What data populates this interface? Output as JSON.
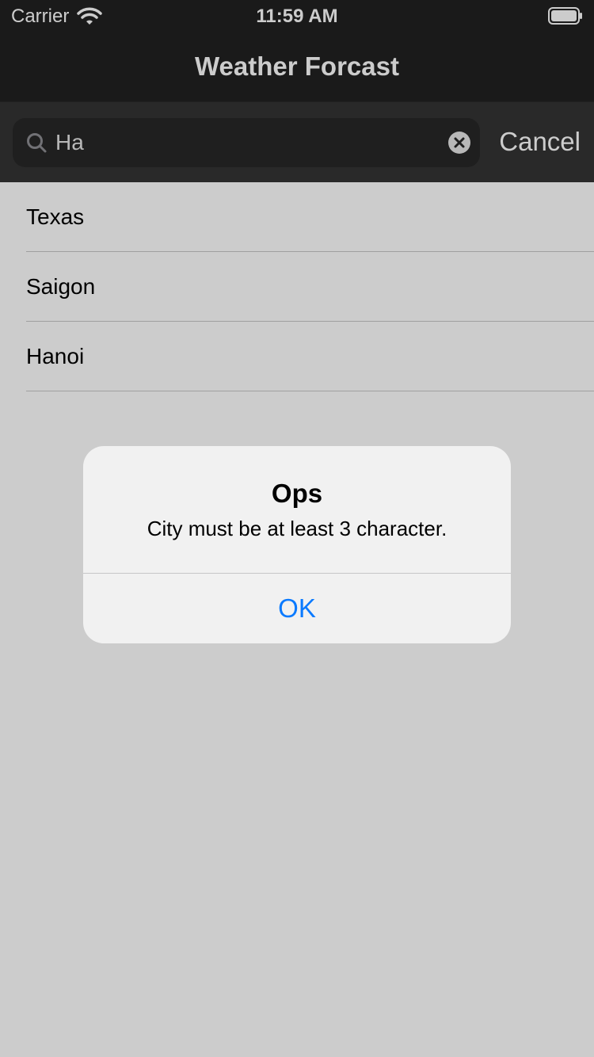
{
  "status_bar": {
    "carrier": "Carrier",
    "time": "11:59 AM"
  },
  "nav": {
    "title": "Weather Forcast"
  },
  "search": {
    "value": "Ha",
    "cancel_label": "Cancel"
  },
  "cities": [
    {
      "name": "Texas"
    },
    {
      "name": "Saigon"
    },
    {
      "name": "Hanoi"
    }
  ],
  "alert": {
    "title": "Ops",
    "message": "City must be at least 3 character.",
    "ok_label": "OK"
  },
  "colors": {
    "accent": "#0a7aff",
    "bar": "#212121"
  },
  "icons": [
    "wifi-icon",
    "battery-icon",
    "search-icon",
    "clear-icon"
  ]
}
